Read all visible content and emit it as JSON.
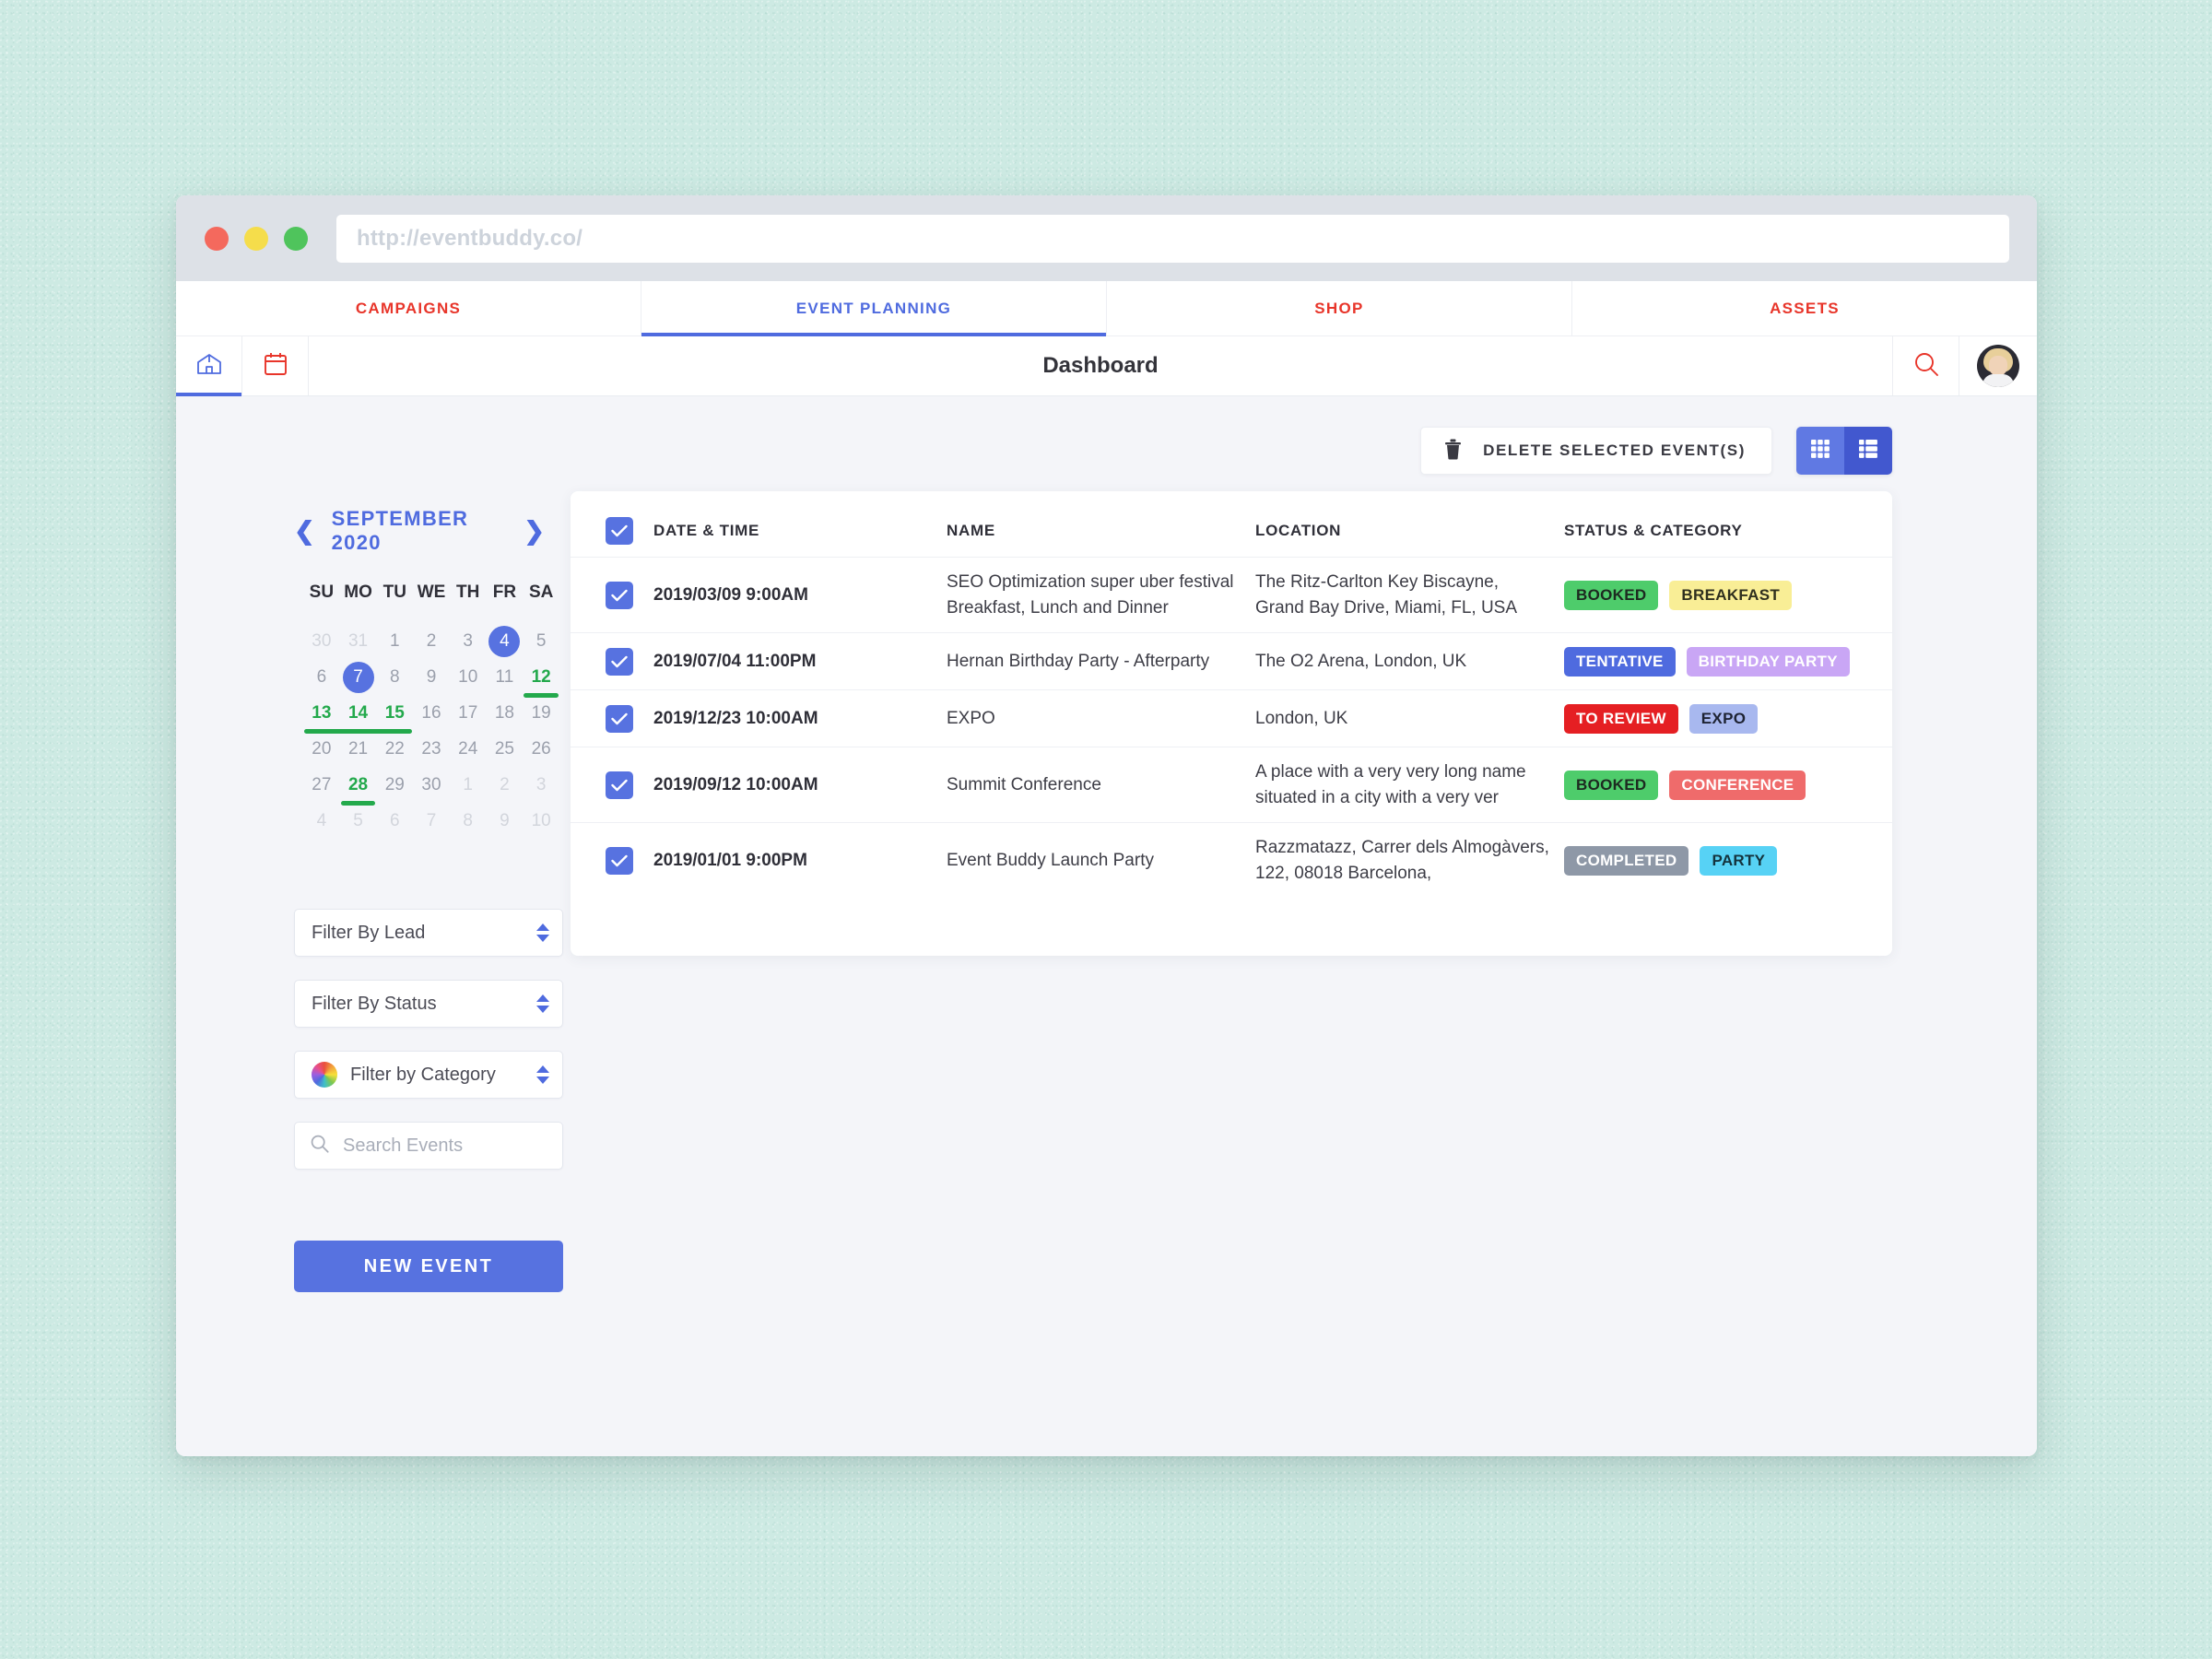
{
  "browser": {
    "url": "http://eventbuddy.co/",
    "lights": [
      "close",
      "minimize",
      "maximize"
    ]
  },
  "tabs": [
    {
      "label": "CAMPAIGNS",
      "active": false
    },
    {
      "label": "EVENT PLANNING",
      "active": true
    },
    {
      "label": "SHOP",
      "active": false
    },
    {
      "label": "ASSETS",
      "active": false
    }
  ],
  "appbar": {
    "home_icon": "home-icon",
    "calendar_icon": "calendar-icon",
    "title": "Dashboard",
    "search_icon": "search-icon",
    "avatar": "user-avatar"
  },
  "toolbar": {
    "delete_label": "DELETE SELECTED EVENT(S)",
    "trash_icon": "trash-icon",
    "grid_view_icon": "grid-view-icon",
    "list_view_icon": "list-view-icon",
    "active_view": "list"
  },
  "calendar": {
    "title": "SEPTEMBER 2020",
    "prev_icon": "chevron-left-icon",
    "next_icon": "chevron-right-icon",
    "dow": [
      "SU",
      "MO",
      "TU",
      "WE",
      "TH",
      "FR",
      "SA"
    ],
    "weeks": [
      [
        {
          "d": "30",
          "state": "muted"
        },
        {
          "d": "31",
          "state": "muted"
        },
        {
          "d": "1",
          "state": "normal"
        },
        {
          "d": "2",
          "state": "normal"
        },
        {
          "d": "3",
          "state": "normal"
        },
        {
          "d": "4",
          "state": "selected"
        },
        {
          "d": "5",
          "state": "normal"
        }
      ],
      [
        {
          "d": "6",
          "state": "normal"
        },
        {
          "d": "7",
          "state": "selected"
        },
        {
          "d": "8",
          "state": "normal"
        },
        {
          "d": "9",
          "state": "normal"
        },
        {
          "d": "10",
          "state": "normal"
        },
        {
          "d": "11",
          "state": "normal"
        },
        {
          "d": "12",
          "state": "event"
        }
      ],
      [
        {
          "d": "13",
          "state": "event-start"
        },
        {
          "d": "14",
          "state": "event-mid"
        },
        {
          "d": "15",
          "state": "event-end"
        },
        {
          "d": "16",
          "state": "normal"
        },
        {
          "d": "17",
          "state": "normal"
        },
        {
          "d": "18",
          "state": "normal"
        },
        {
          "d": "19",
          "state": "normal"
        }
      ],
      [
        {
          "d": "20",
          "state": "normal"
        },
        {
          "d": "21",
          "state": "normal"
        },
        {
          "d": "22",
          "state": "normal"
        },
        {
          "d": "23",
          "state": "normal"
        },
        {
          "d": "24",
          "state": "normal"
        },
        {
          "d": "25",
          "state": "normal"
        },
        {
          "d": "26",
          "state": "normal"
        }
      ],
      [
        {
          "d": "27",
          "state": "normal"
        },
        {
          "d": "28",
          "state": "event"
        },
        {
          "d": "29",
          "state": "normal"
        },
        {
          "d": "30",
          "state": "normal"
        },
        {
          "d": "1",
          "state": "muted"
        },
        {
          "d": "2",
          "state": "muted"
        },
        {
          "d": "3",
          "state": "muted"
        }
      ],
      [
        {
          "d": "4",
          "state": "muted"
        },
        {
          "d": "5",
          "state": "muted"
        },
        {
          "d": "6",
          "state": "muted"
        },
        {
          "d": "7",
          "state": "muted"
        },
        {
          "d": "8",
          "state": "muted"
        },
        {
          "d": "9",
          "state": "muted"
        },
        {
          "d": "10",
          "state": "muted"
        }
      ]
    ]
  },
  "filters": {
    "lead": "Filter By Lead",
    "status": "Filter By Status",
    "category": "Filter by Category",
    "category_icon": "color-wheel-icon",
    "search_placeholder": "Search Events",
    "search_value": "",
    "search_icon": "search-icon",
    "new_event_label": "NEW EVENT"
  },
  "table": {
    "columns": [
      "DATE & TIME",
      "NAME",
      "LOCATION",
      "STATUS & CATEGORY"
    ],
    "header_checked": true,
    "rows": [
      {
        "checked": true,
        "date": "2019/03/09 9:00AM",
        "name": "SEO Optimization super uber festival Breakfast, Lunch and Dinner",
        "location": "The Ritz-Carlton Key Biscayne, Grand Bay Drive, Miami, FL, USA",
        "status": {
          "label": "BOOKED",
          "bg": "#4ecc6b",
          "fg": "#1d2a20"
        },
        "category": {
          "label": "BREAKFAST",
          "bg": "#f9ee96",
          "fg": "#2f2f1e"
        }
      },
      {
        "checked": true,
        "date": "2019/07/04 11:00PM",
        "name": "Hernan Birthday Party - Afterparty",
        "location": "The O2 Arena, London, UK",
        "status": {
          "label": "TENTATIVE",
          "bg": "#4f6bdf",
          "fg": "#ffffff"
        },
        "category": {
          "label": "BIRTHDAY PARTY",
          "bg": "#c9a6f5",
          "fg": "#ffffff"
        }
      },
      {
        "checked": true,
        "date": "2019/12/23 10:00AM",
        "name": "EXPO",
        "location": "London, UK",
        "status": {
          "label": "TO REVIEW",
          "bg": "#e51f23",
          "fg": "#ffffff"
        },
        "category": {
          "label": "EXPO",
          "bg": "#a8b8ef",
          "fg": "#1e2333"
        }
      },
      {
        "checked": true,
        "date": "2019/09/12 10:00AM",
        "name": "Summit Conference",
        "location": "A place with a very very long name situated in a city with a very ver",
        "status": {
          "label": "BOOKED",
          "bg": "#4ecc6b",
          "fg": "#1d2a20"
        },
        "category": {
          "label": "CONFERENCE",
          "bg": "#ef6b6b",
          "fg": "#ffffff"
        }
      },
      {
        "checked": true,
        "date": "2019/01/01 9:00PM",
        "name": "Event Buddy Launch Party",
        "location": "Razzmatazz, Carrer dels Almogàvers, 122, 08018 Barcelona,",
        "status": {
          "label": "COMPLETED",
          "bg": "#8e98a7",
          "fg": "#ffffff"
        },
        "category": {
          "label": "PARTY",
          "bg": "#57d2f5",
          "fg": "#14333d"
        }
      }
    ]
  },
  "colors": {
    "accent_blue": "#4f6bdf",
    "accent_red": "#e8352a",
    "event_green": "#23a94c",
    "page_bg": "#f4f5f9",
    "desktop_bg": "#cdeae3"
  }
}
